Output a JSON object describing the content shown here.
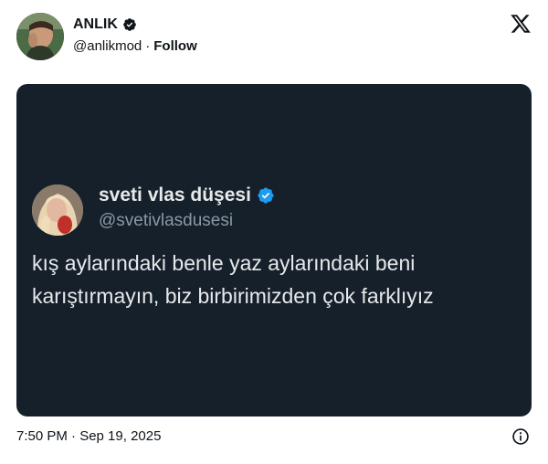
{
  "author": {
    "name": "ANLIK",
    "handle": "@anlikmod",
    "separator": "·",
    "follow_label": "Follow",
    "avatar_icon": "profile-photo",
    "verified_icon": "verified-badge-icon"
  },
  "brand": {
    "logo_icon": "x-logo-icon"
  },
  "embedded_post": {
    "name": "sveti vlas düşesi",
    "handle": "@svetivlasdusesi",
    "verified_color": "#1d9bf0",
    "text_line1": "kış aylarındaki benle yaz aylarındaki beni",
    "text_line2": "karıştırmayın, biz birbirimizden çok farklıyız",
    "background_color": "#15202b"
  },
  "footer": {
    "timestamp": "7:50 PM · Sep 19, 2025",
    "info_icon": "info-icon"
  }
}
